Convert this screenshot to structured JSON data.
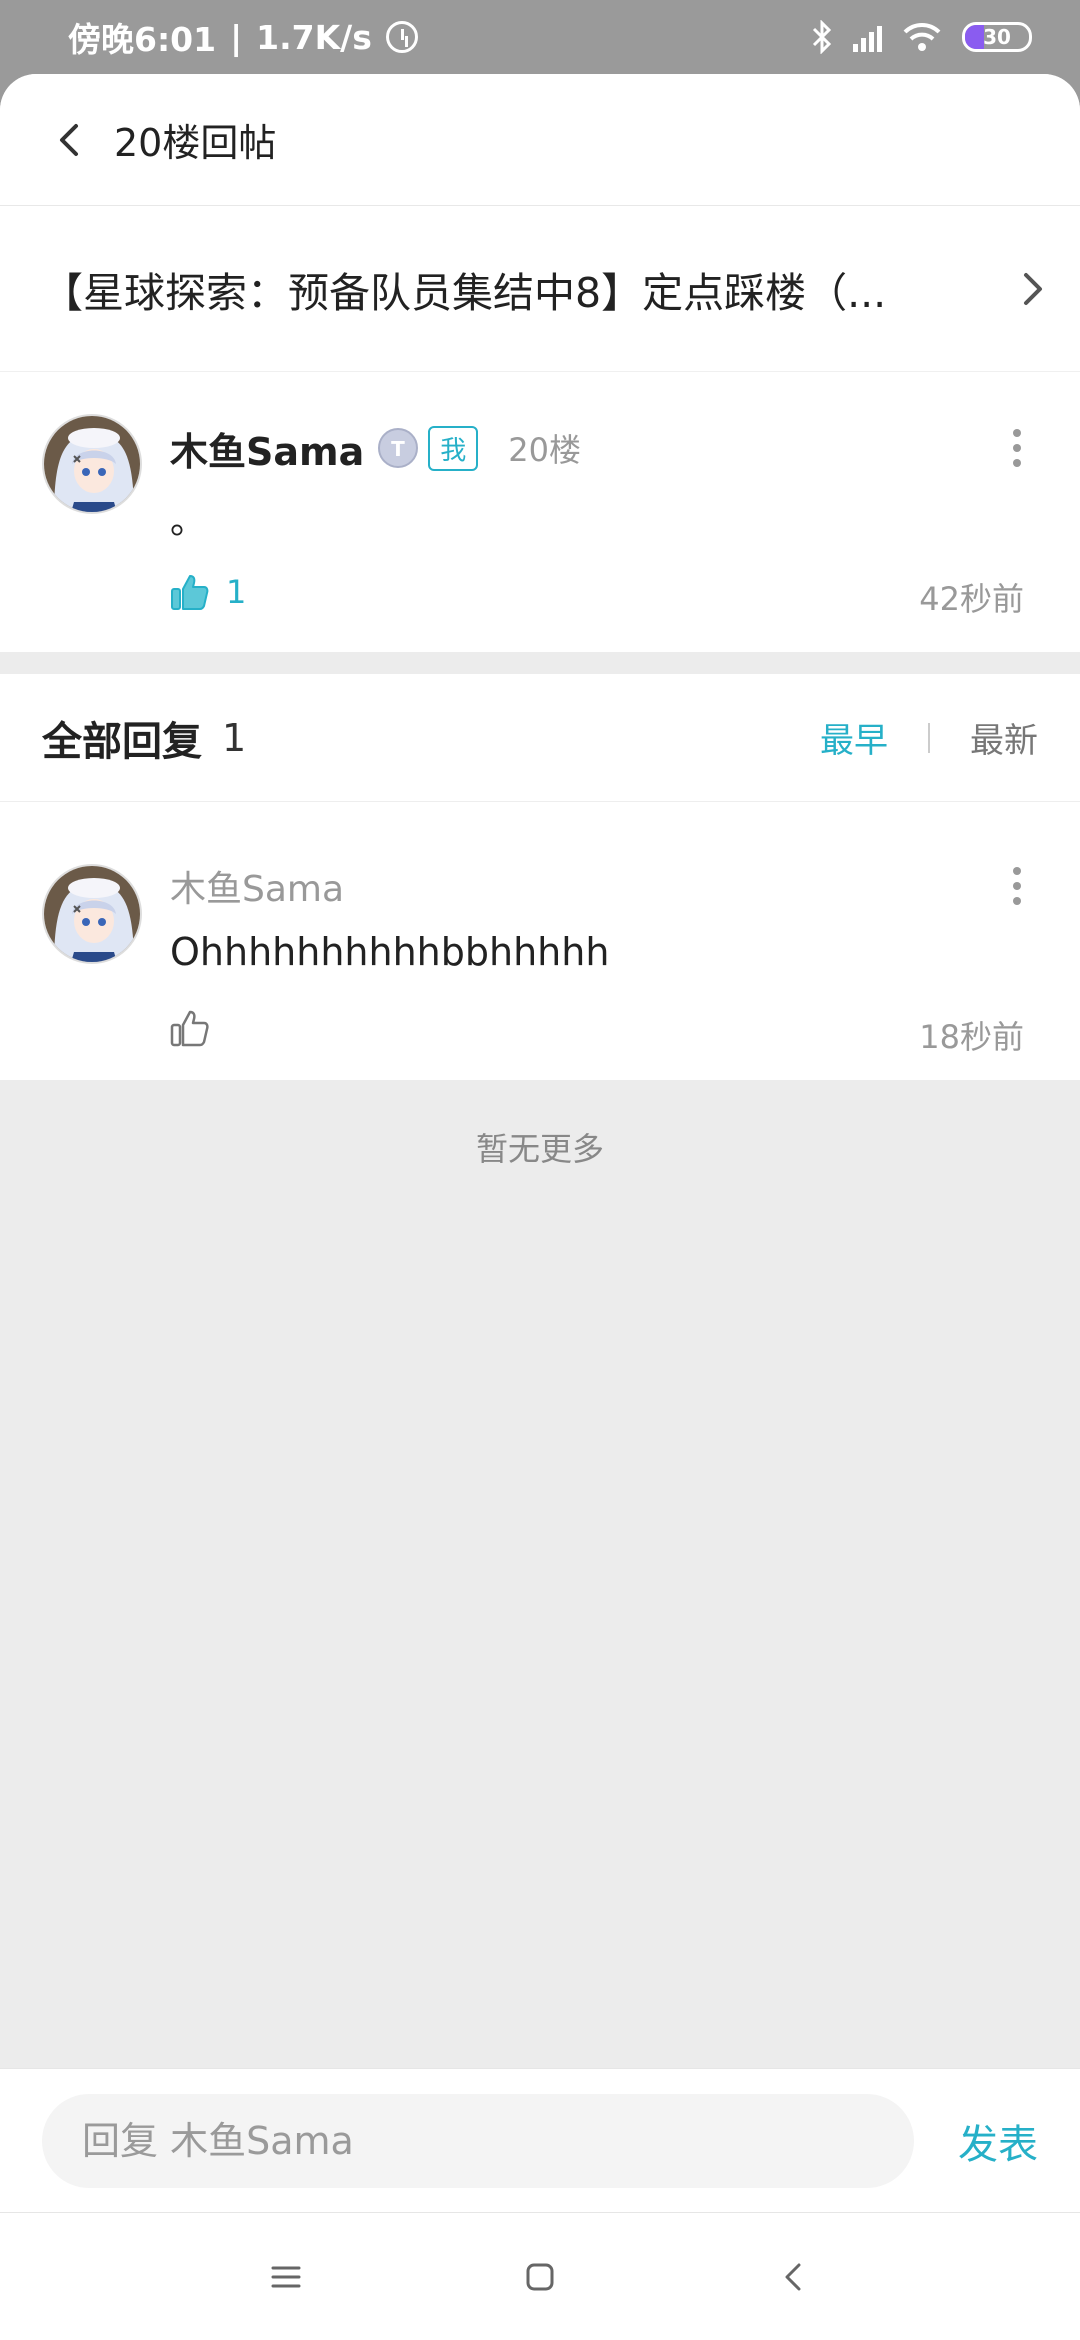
{
  "status_bar": {
    "time": "傍晚6:01",
    "net_speed": "1.7K/s",
    "battery": "30",
    "battery_fraction": 0.3
  },
  "header": {
    "title": "20楼回帖"
  },
  "topic": {
    "title": "【星球探索：预备队员集结中8】定点踩楼（..."
  },
  "post": {
    "author": "木鱼Sama",
    "me_badge": "我",
    "floor": "20楼",
    "content": "。",
    "like_count": "1",
    "time": "42秒前"
  },
  "replies": {
    "title": "全部回复",
    "count": "1",
    "sort_earliest": "最早",
    "sort_newest": "最新",
    "items": [
      {
        "author": "木鱼Sama",
        "content": "Ohhhhhhhhhhbbhhhhh",
        "time": "18秒前"
      }
    ],
    "no_more": "暂无更多"
  },
  "reply_bar": {
    "placeholder": "回复 木鱼Sama",
    "send_label": "发表"
  },
  "colors": {
    "accent": "#26b0c8",
    "battery": "#8a5cf0"
  }
}
